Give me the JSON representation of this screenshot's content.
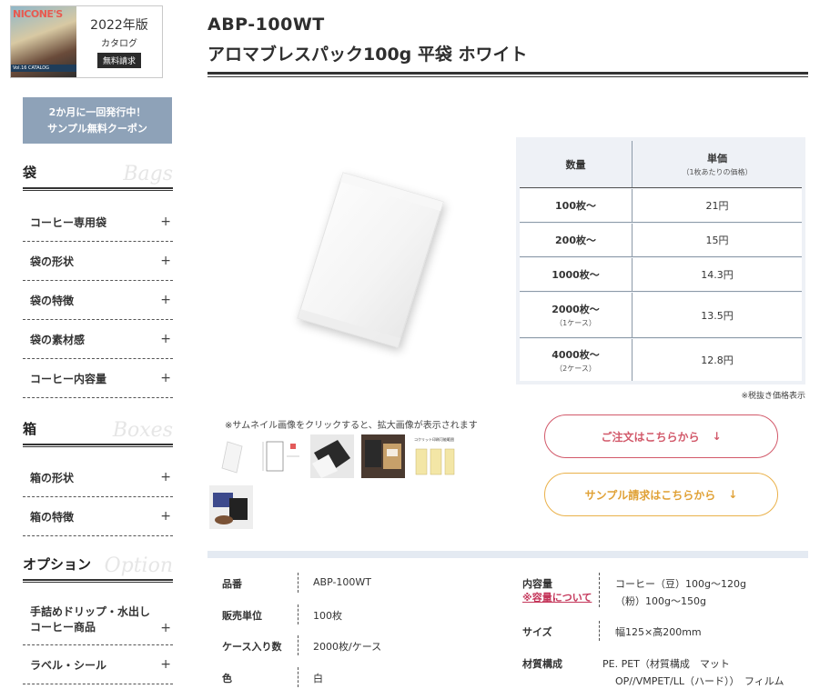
{
  "sidebar": {
    "catalog": {
      "brand": "NICONE'S",
      "cover_text": "Vol.16 CATALOG",
      "year": "2022年版",
      "label": "カタログ",
      "free": "無料請求"
    },
    "coupon": {
      "line1": "2か月に一回発行中！",
      "line2": "サンプル無料クーポン"
    },
    "sections": [
      {
        "title": "袋",
        "title_en": "Bags",
        "items": [
          "コーヒー専用袋",
          "袋の形状",
          "袋の特徴",
          "袋の素材感",
          "コーヒー内容量"
        ]
      },
      {
        "title": "箱",
        "title_en": "Boxes",
        "items": [
          "箱の形状",
          "箱の特徴"
        ]
      },
      {
        "title": "オプション",
        "title_en": "Option",
        "items": [
          "手詰めドリップ・水出しコーヒー商品",
          "ラベル・シール"
        ]
      }
    ],
    "plus_symbol": "+"
  },
  "product": {
    "sku": "ABP-100WT",
    "name": "アロマブレスパック100g 平袋 ホワイト"
  },
  "price_table": {
    "head_qty": "数量",
    "head_price": "単価",
    "head_price_sub": "（1枚あたりの価格）",
    "rows": [
      {
        "qty": "100枚～",
        "sub": "",
        "price": "21円"
      },
      {
        "qty": "200枚～",
        "sub": "",
        "price": "15円"
      },
      {
        "qty": "1000枚～",
        "sub": "",
        "price": "14.3円"
      },
      {
        "qty": "2000枚～",
        "sub": "（1ケース）",
        "price": "13.5円"
      },
      {
        "qty": "4000枚～",
        "sub": "（2ケース）",
        "price": "12.8円"
      }
    ],
    "tax_note": "※税抜き価格表示"
  },
  "thumbnails": {
    "note": "※サムネイル画像をクリックすると、拡大画像が表示されます",
    "thumb2_text": "コクリット印刷可能範囲"
  },
  "buttons": {
    "order": "ご注文はこちらから",
    "sample": "サンプル請求はこちらから",
    "arrow": "↓"
  },
  "specs": {
    "left": [
      {
        "label": "品番",
        "value": "ABP-100WT"
      },
      {
        "label": "販売単位",
        "value": "100枚"
      },
      {
        "label": "ケース入り数",
        "value": "2000枚/ケース"
      },
      {
        "label": "色",
        "value": "白"
      }
    ],
    "capacity": {
      "label": "内容量",
      "link": "※容量について",
      "line1": "コーヒー（豆）100g～120g",
      "line2": "（粉）100g～150g"
    },
    "size": {
      "label": "サイズ",
      "value": "幅125×高200mm"
    },
    "material": {
      "label": "材質構成",
      "line1": "PE. PET（材質構成　マット",
      "line2": "OP//VMPET/LL（ハード））　フィルム"
    }
  },
  "colors": {
    "coupon_bg": "#8ea2b8",
    "order_accent": "#d2596a",
    "sample_accent": "#e0a136",
    "table_bg": "#eef1f6",
    "spec_band": "#e4eaf2",
    "link": "#c4365a"
  }
}
